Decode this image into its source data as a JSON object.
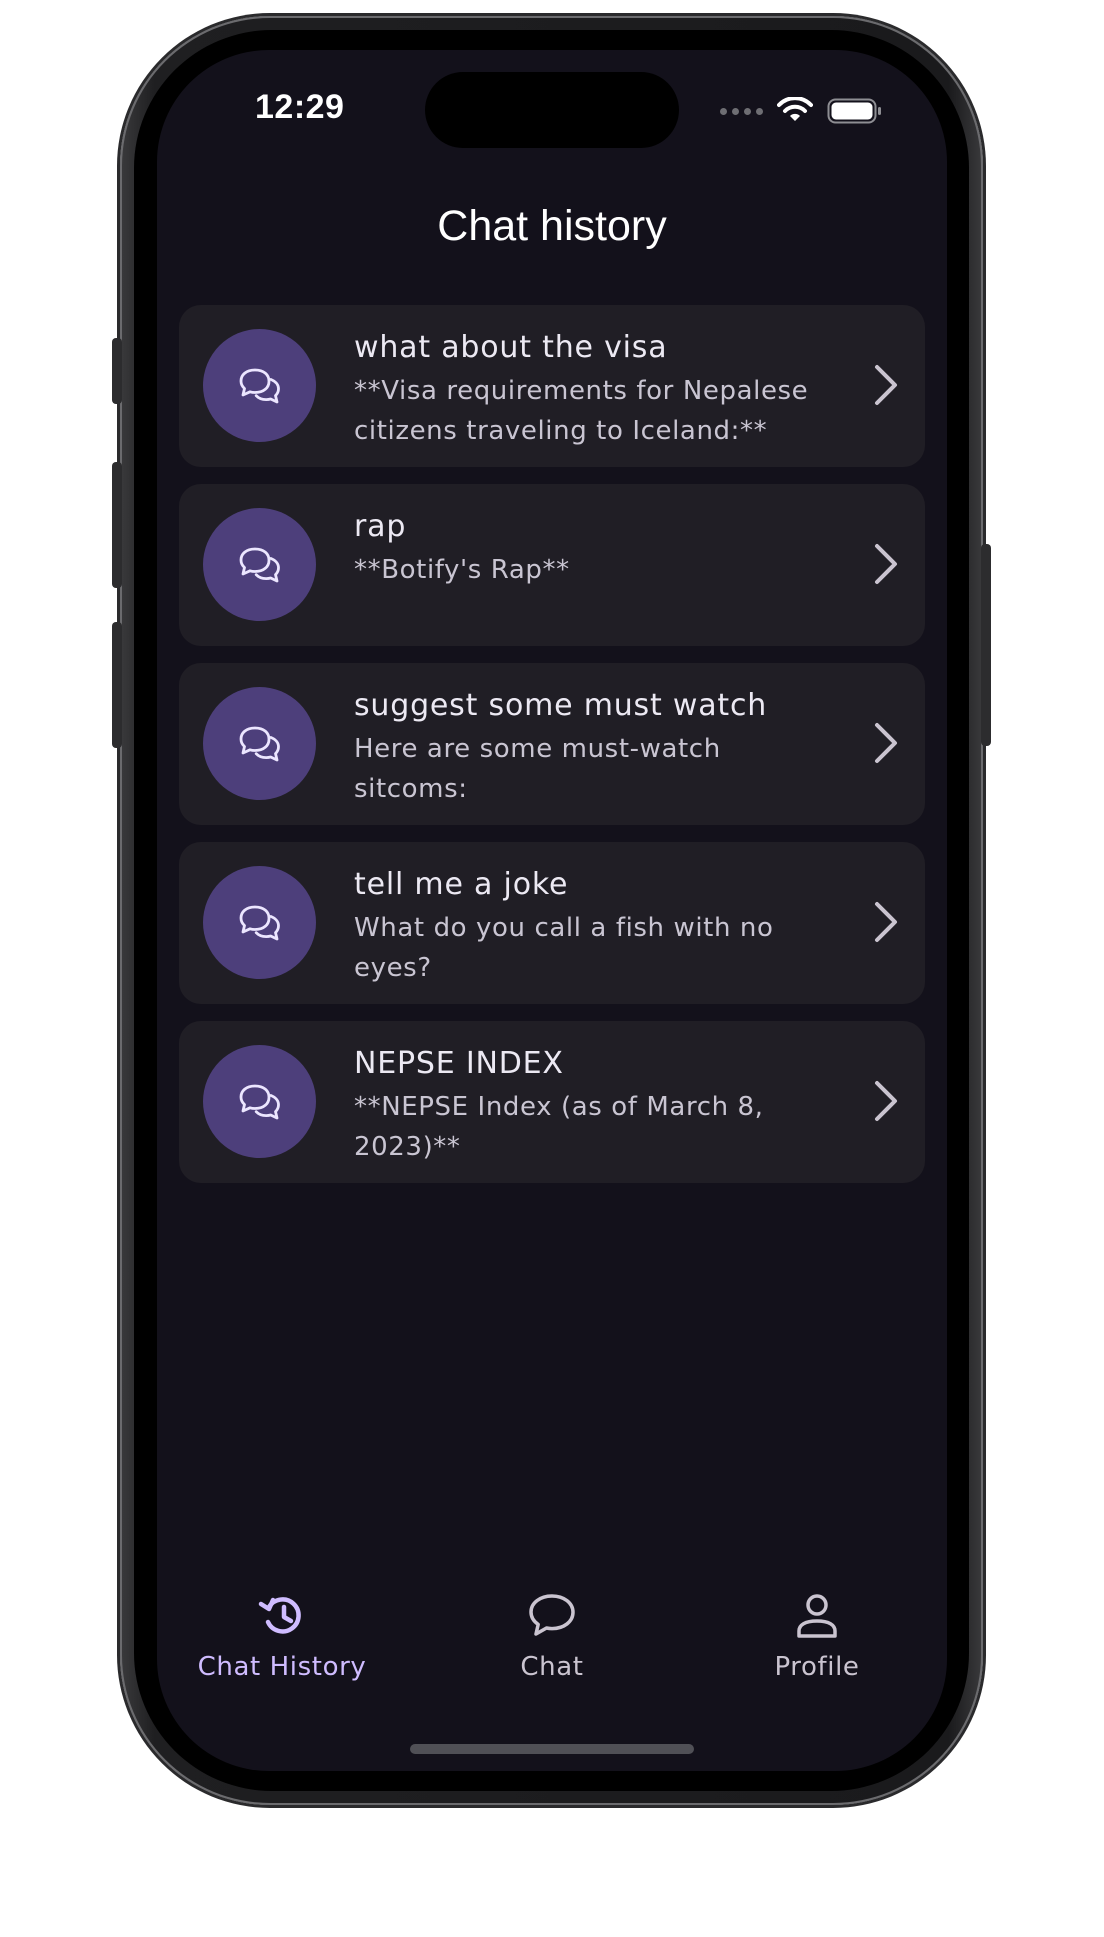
{
  "status_bar": {
    "time": "12:29"
  },
  "page": {
    "title": "Chat history"
  },
  "chats": [
    {
      "title": "what about the visa",
      "preview": "**Visa requirements for Nepalese citizens traveling to Iceland:**"
    },
    {
      "title": "rap",
      "preview": "**Botify's Rap**"
    },
    {
      "title": "suggest some must watch",
      "preview": "Here are some must-watch sitcoms:"
    },
    {
      "title": "tell me a joke",
      "preview": "What do you call a fish with no eyes?"
    },
    {
      "title": "NEPSE INDEX",
      "preview": "**NEPSE Index (as of March 8, 2023)**"
    }
  ],
  "bottom_nav": {
    "items": [
      {
        "label": "Chat History",
        "icon": "history-icon",
        "active": true
      },
      {
        "label": "Chat",
        "icon": "chat-bubble-icon",
        "active": false
      },
      {
        "label": "Profile",
        "icon": "person-icon",
        "active": false
      }
    ]
  },
  "colors": {
    "background": "#13111b",
    "card": "#201e25",
    "avatar": "#4d3f7b",
    "accent": "#cfbcff",
    "text_primary": "#ece9f3",
    "text_secondary": "#c9c5d2"
  }
}
